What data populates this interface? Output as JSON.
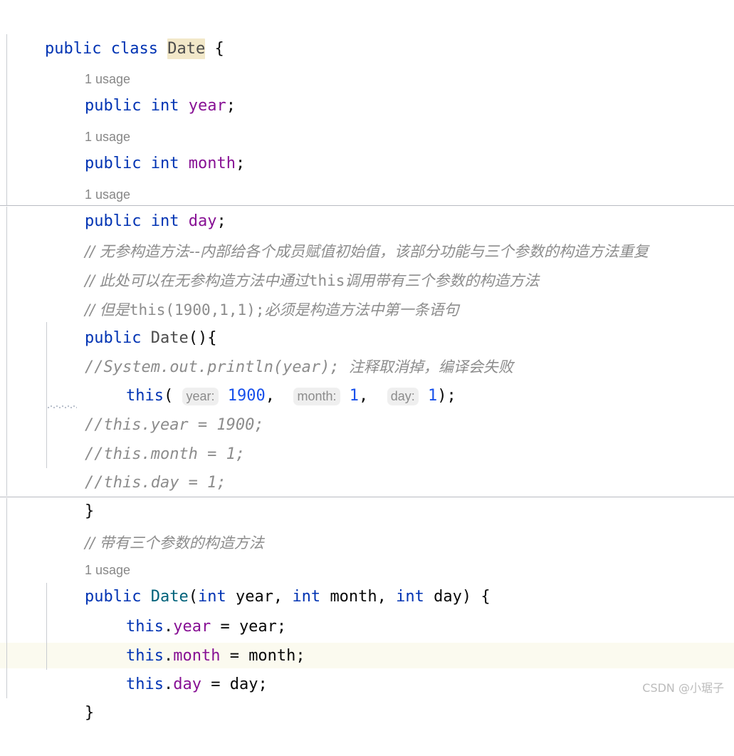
{
  "editor": {
    "language": "java",
    "file_class": "Date",
    "background_color": "#ffffff",
    "caret_line_color": "#fbfaef",
    "occurrence_highlight_color": "#f2e8c9",
    "keyword_color": "#0033b3",
    "field_color": "#871094",
    "number_color": "#1750eb",
    "comment_color": "#8c8c8c",
    "class_decl_color": "#00627a",
    "inlay_hint_bg": "#efefef",
    "inlay_hint_color": "#8c8c8c",
    "guide_color": "#c9ccd1",
    "separator_color": "#b9bcc2"
  },
  "lines": {
    "l1": {
      "kw_public": "public",
      "kw_class": "class",
      "name": "Date",
      "brace": "{"
    },
    "usage_year": "1 usage",
    "l2": {
      "kw_public": "public",
      "kw_int": "int",
      "field": "year",
      "semi": ";"
    },
    "usage_month": "1 usage",
    "l3": {
      "kw_public": "public",
      "kw_int": "int",
      "field": "month",
      "semi": ";"
    },
    "usage_day": "1 usage",
    "l4": {
      "kw_public": "public",
      "kw_int": "int",
      "field": "day",
      "semi": ";"
    },
    "comment1": "// 无参构造方法--内部给各个成员赋值初始值，该部分功能与三个参数的构造方法重复",
    "comment2_a": "// 此处可以在无参构造方法中通过",
    "comment2_mono": "this",
    "comment2_b": "调用带有三个参数的构造方法",
    "comment3_a": "// 但是",
    "comment3_mono": "this(1900,1,1);",
    "comment3_b": "必须是构造方法中第一条语句",
    "ctor_noarg": {
      "kw_public": "public",
      "name": "Date",
      "sig": "(){"
    },
    "comment_println_code": "//System.out.println(year);",
    "comment_println_cn": "注释取消掉，编译会失败",
    "this_call": {
      "this": "this",
      "open": "(",
      "hint_year": "year:",
      "val_year": "1900",
      "comma1": ",",
      "hint_month": "month:",
      "val_month": "1",
      "comma2": ",",
      "hint_day": "day:",
      "val_day": "1",
      "close": ");"
    },
    "commented_year": "//this.year = 1900;",
    "commented_month": "//this.month = 1;",
    "commented_day": "//this.day = 1;",
    "close_brace_ctor": "}",
    "comment4": "// 带有三个参数的构造方法",
    "usage_ctor": "1 usage",
    "ctor_args": {
      "kw_public": "public",
      "name": "Date",
      "paren_open": "(",
      "kw_int1": "int",
      "p1": "year,",
      "kw_int2": "int",
      "p2": "month,",
      "kw_int3": "int",
      "p3": "day",
      "paren_close": ") {"
    },
    "assign_year": {
      "this": "this",
      "dot": ".",
      "field": "year",
      "rest": " = year;"
    },
    "assign_month": {
      "this": "this",
      "dot": ".",
      "field": "month",
      "rest": " = month;"
    },
    "assign_day": {
      "this": "this",
      "dot": ".",
      "field": "day",
      "rest": " = day;"
    },
    "close_brace_ctor2": "}"
  },
  "watermark": "CSDN @小琚子"
}
